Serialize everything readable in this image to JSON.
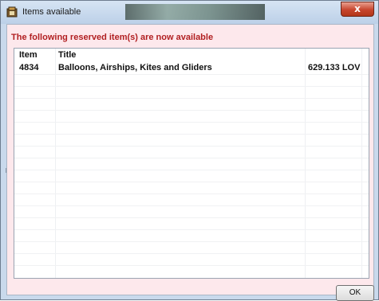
{
  "window": {
    "title": "Items available",
    "close_label": "x"
  },
  "notice": "The following reserved item(s) are now available",
  "table": {
    "columns": [
      "Item",
      "Title",
      ""
    ],
    "rows": [
      [
        "4834",
        "Balloons, Airships, Kites and Gliders",
        "629.133 LOV"
      ]
    ]
  },
  "ok_label": "OK"
}
